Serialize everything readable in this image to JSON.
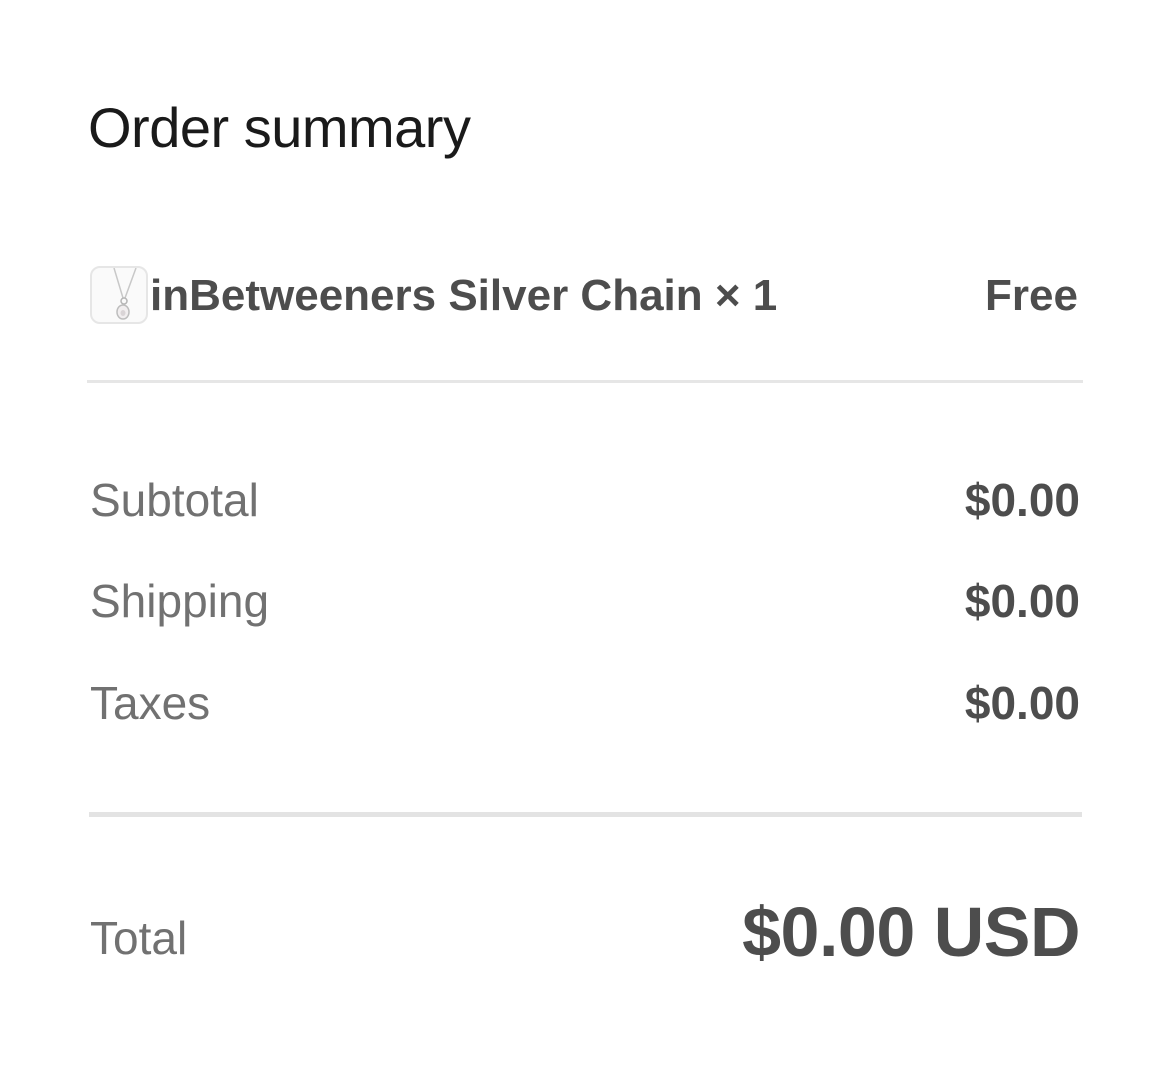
{
  "summary": {
    "title": "Order summary"
  },
  "item": {
    "image_icon": "silver-chain-pendant-icon",
    "name": "inBetweeners Silver Chain",
    "quantity": "× 1",
    "price": "Free"
  },
  "costs": {
    "subtotal_label": "Subtotal",
    "subtotal_value": "$0.00",
    "shipping_label": "Shipping",
    "shipping_value": "$0.00",
    "taxes_label": "Taxes",
    "taxes_value": "$0.00"
  },
  "total": {
    "label": "Total",
    "value": "$0.00 USD"
  }
}
